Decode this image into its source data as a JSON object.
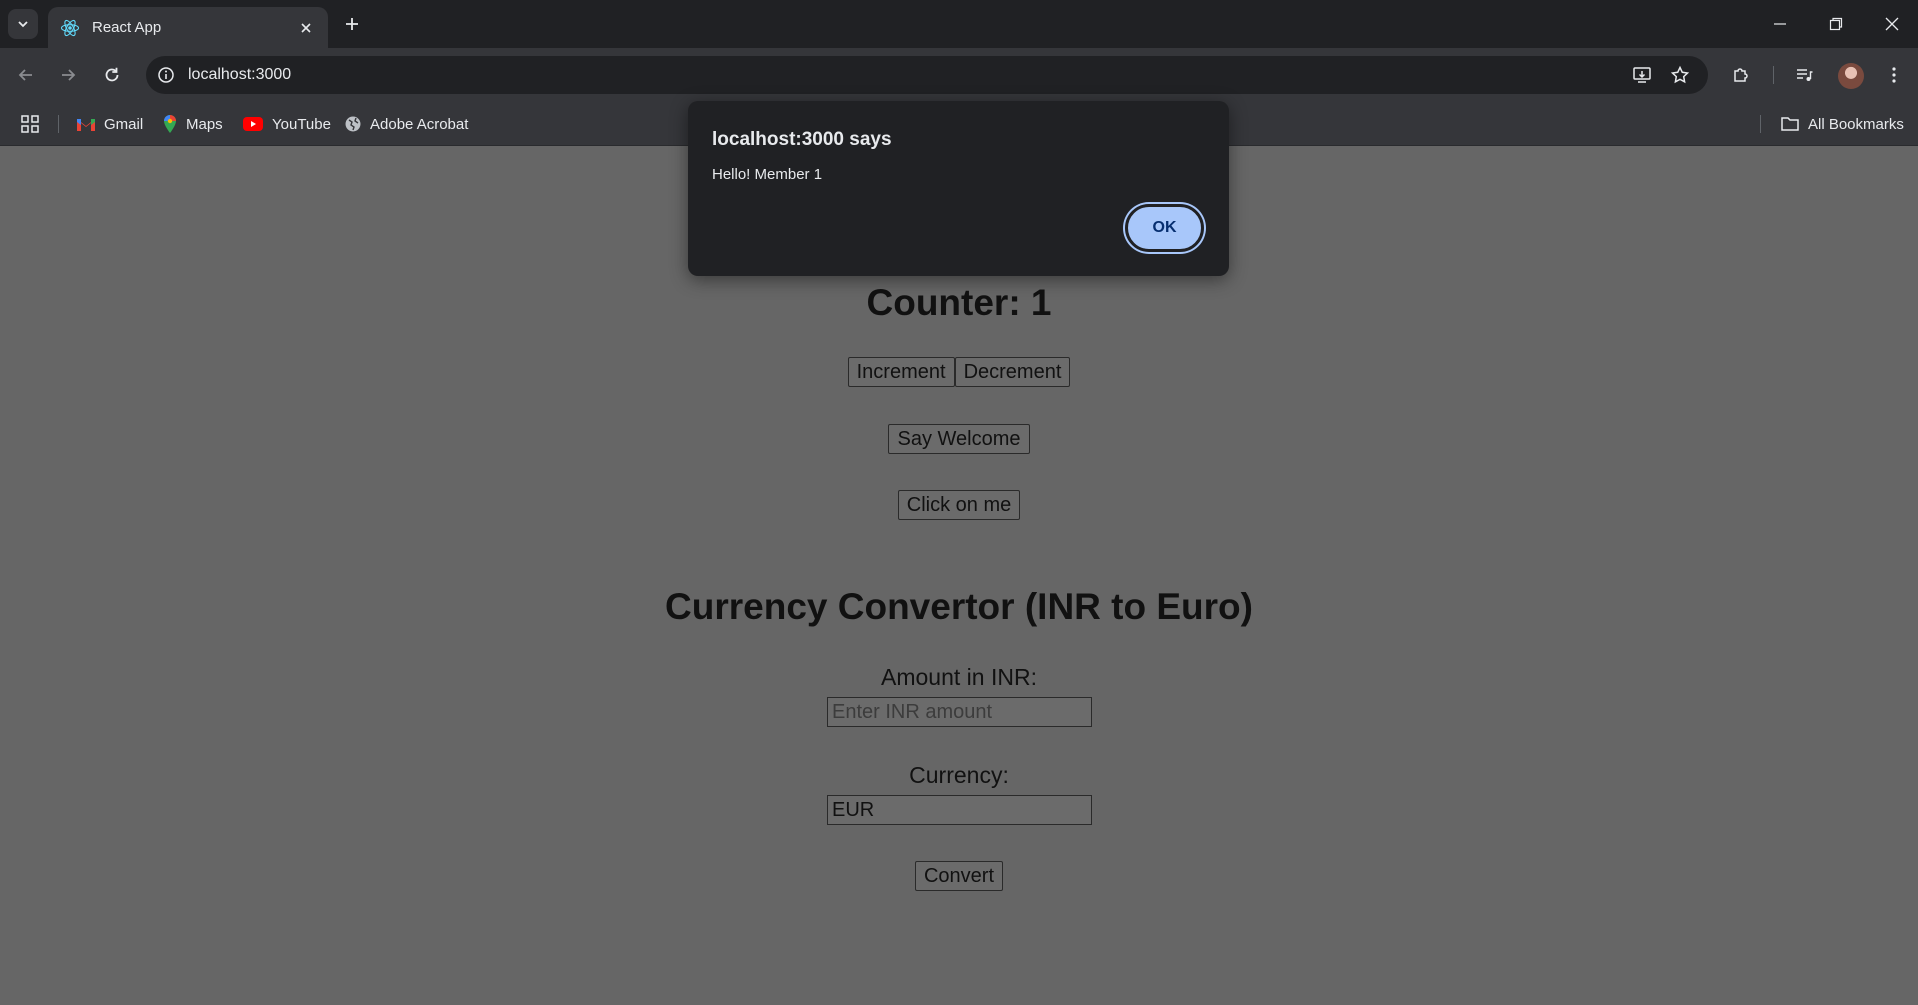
{
  "browser": {
    "tab_title": "React App",
    "url": "localhost:3000",
    "bookmarks": [
      {
        "label": "Gmail",
        "icon": "gmail-icon"
      },
      {
        "label": "Maps",
        "icon": "maps-icon"
      },
      {
        "label": "YouTube",
        "icon": "youtube-icon"
      },
      {
        "label": "Adobe Acrobat",
        "icon": "globe-icon"
      }
    ],
    "all_bookmarks_label": "All Bookmarks"
  },
  "page": {
    "counter_title": "Counter: 1",
    "increment_label": "Increment",
    "decrement_label": "Decrement",
    "say_welcome_label": "Say Welcome",
    "click_me_label": "Click on me",
    "currency_title": "Currency Convertor (INR to Euro)",
    "amount_label": "Amount in INR:",
    "amount_placeholder": "Enter INR amount",
    "currency_label": "Currency:",
    "currency_value": "EUR",
    "convert_label": "Convert"
  },
  "dialog": {
    "title": "localhost:3000 says",
    "message": "Hello! Member 1",
    "ok_label": "OK"
  },
  "colors": {
    "page_bg": "#666666",
    "chrome_dark": "#202124",
    "chrome_toolbar": "#35363a",
    "ok_button": "#a8c7fa"
  }
}
